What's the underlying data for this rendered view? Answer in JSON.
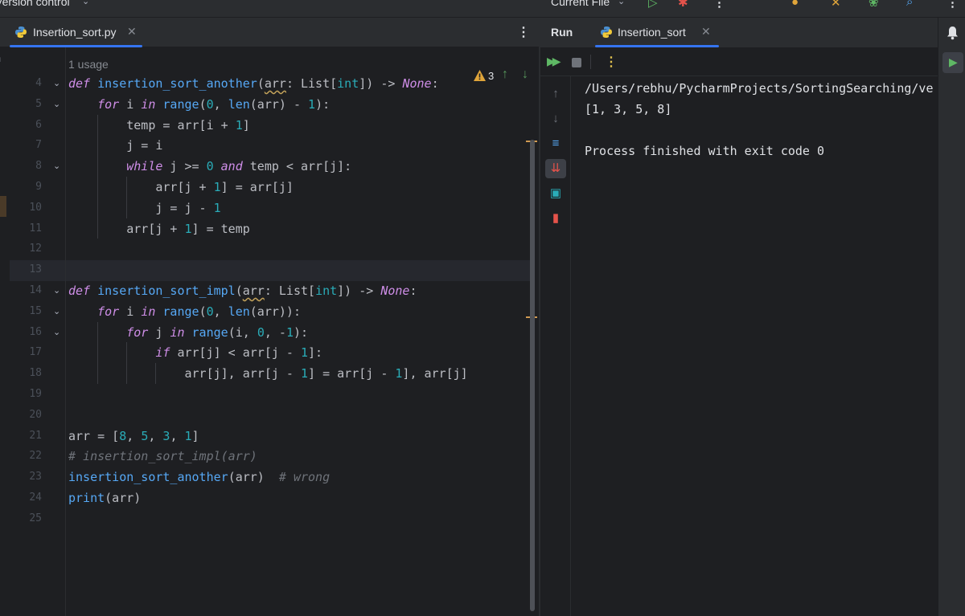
{
  "topbar": {
    "vcs_label": "Version control",
    "run_config_label": "Current File"
  },
  "editor": {
    "tab_label": "Insertion_sort.py",
    "usage_hint": "1 usage",
    "warning_count": "3",
    "line_numbers": [
      "4",
      "5",
      "6",
      "7",
      "8",
      "9",
      "10",
      "11",
      "12",
      "13",
      "14",
      "15",
      "16",
      "17",
      "18",
      "19",
      "20",
      "21",
      "22",
      "23",
      "24",
      "25"
    ],
    "code": [
      "def insertion_sort_another(arr: List[int]) -> None:",
      "    for i in range(0, len(arr) - 1):",
      "        temp = arr[i + 1]",
      "        j = i",
      "        while j >= 0 and temp < arr[j]:",
      "            arr[j + 1] = arr[j]",
      "            j = j - 1",
      "        arr[j + 1] = temp",
      "",
      "",
      "def insertion_sort_impl(arr: List[int]) -> None:",
      "    for i in range(0, len(arr)):",
      "        for j in range(i, 0, -1):",
      "            if arr[j] < arr[j - 1]:",
      "                arr[j], arr[j - 1] = arr[j - 1], arr[j]",
      "",
      "",
      "arr = [8, 5, 3, 1]",
      "# insertion_sort_impl(arr)",
      "insertion_sort_another(arr)  # wrong",
      "print(arr)",
      ""
    ]
  },
  "run": {
    "title": "Run",
    "tab_label": "Insertion_sort",
    "output": [
      "/Users/rebhu/PycharmProjects/SortingSearching/ve",
      "[1, 3, 5, 8]",
      "",
      "Process finished with exit code 0"
    ]
  },
  "icons": {
    "python": "python-icon",
    "warning": "warning-icon",
    "bell": "bell-icon"
  },
  "colors": {
    "accent": "#3574f0",
    "keyword": "#cf8ee8",
    "function": "#56a8f5",
    "number": "#2aacb8",
    "run_green": "#5fb865",
    "warning": "#e0a53a"
  }
}
